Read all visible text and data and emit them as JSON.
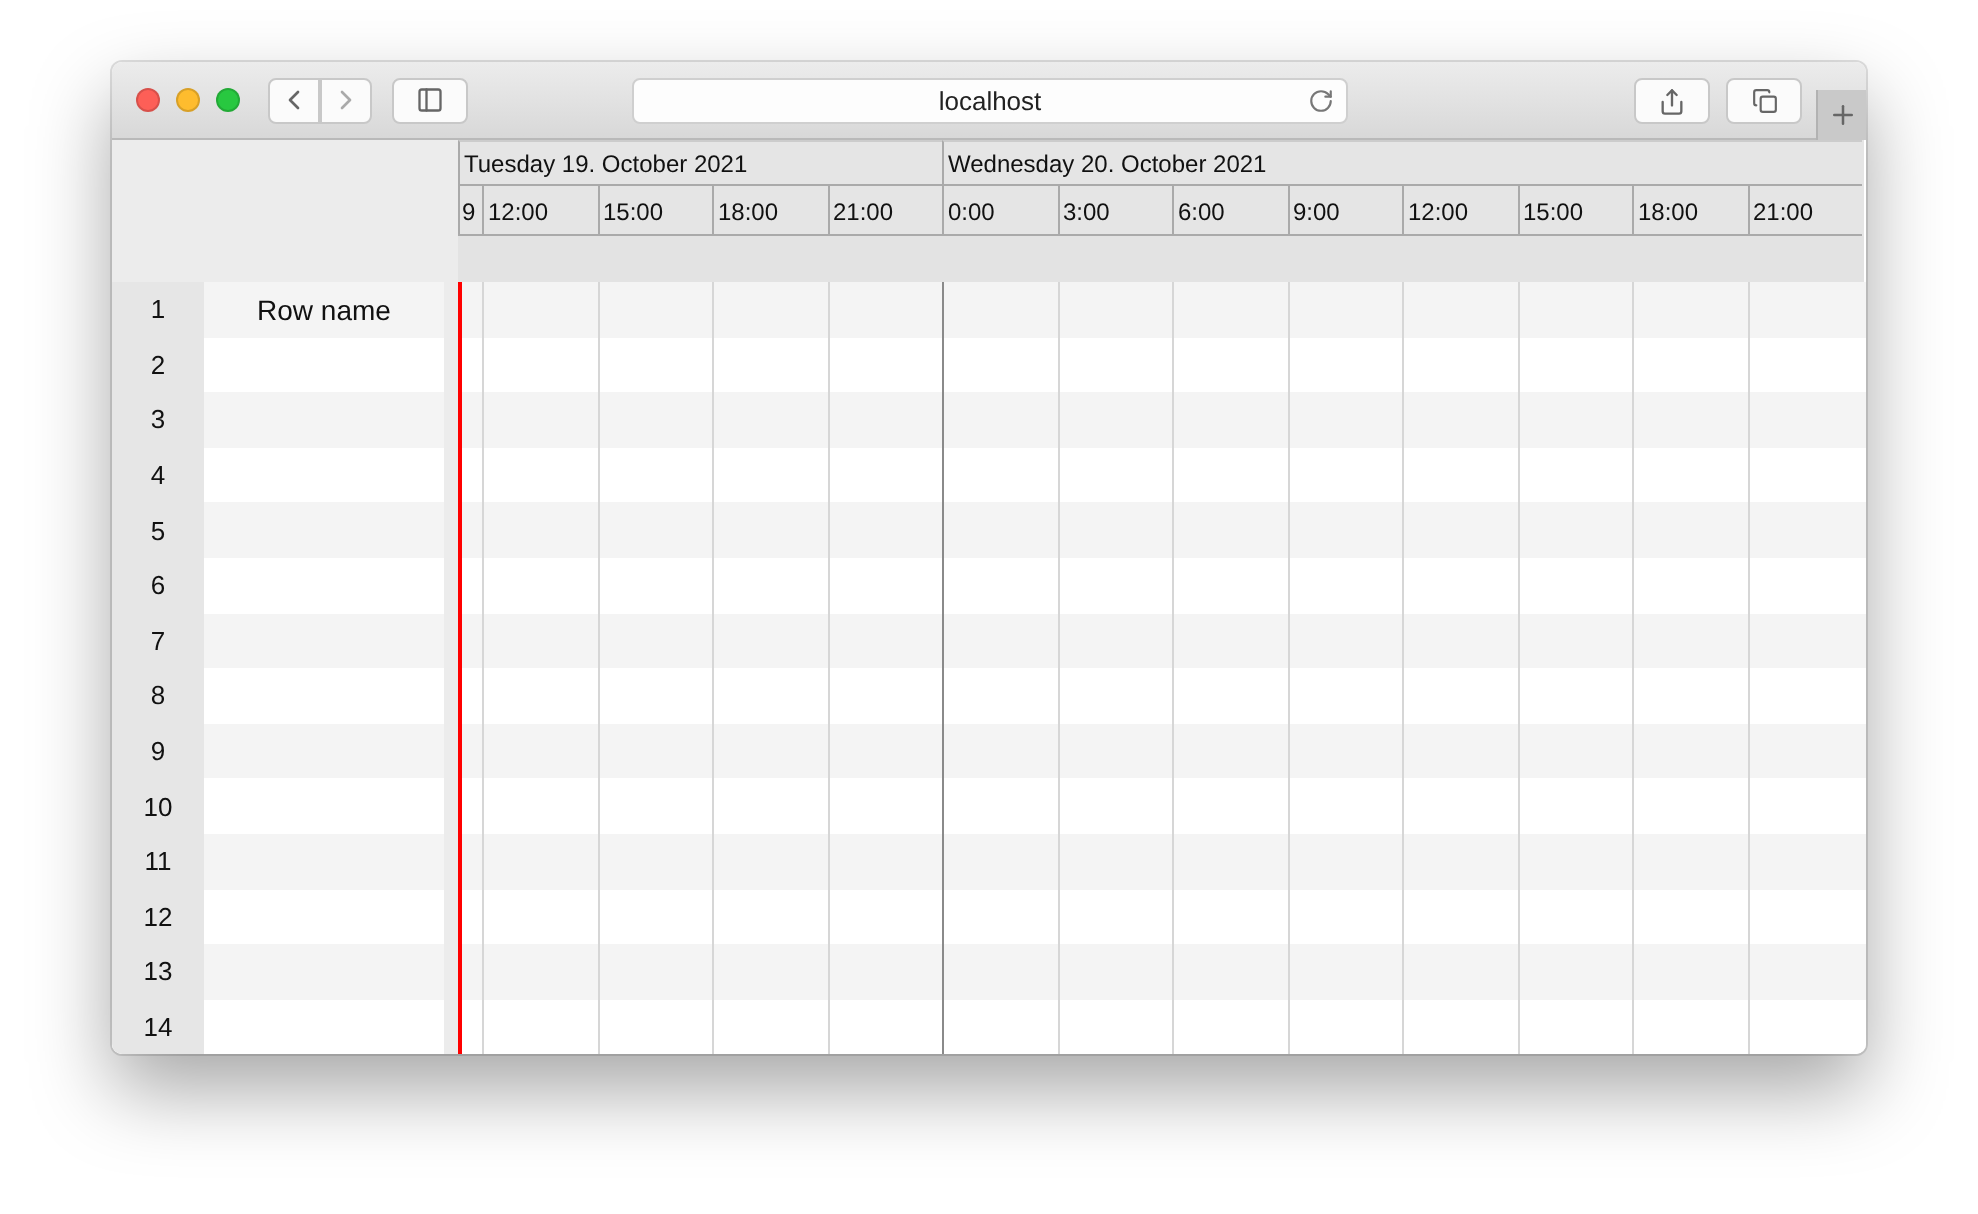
{
  "window": {
    "title": "localhost"
  },
  "days": [
    {
      "label": "Tuesday 19. October 2021",
      "hours": [
        {
          "label": "9",
          "kind": "partial"
        },
        {
          "label": "12:00",
          "kind": "full"
        },
        {
          "label": "15:00",
          "kind": "full"
        },
        {
          "label": "18:00",
          "kind": "full"
        },
        {
          "label": "21:00",
          "kind": "full"
        }
      ]
    },
    {
      "label": "Wednesday 20. October 2021",
      "hours": [
        {
          "label": "0:00",
          "kind": "full"
        },
        {
          "label": "3:00",
          "kind": "full"
        },
        {
          "label": "6:00",
          "kind": "full"
        },
        {
          "label": "9:00",
          "kind": "full"
        },
        {
          "label": "12:00",
          "kind": "full"
        },
        {
          "label": "15:00",
          "kind": "full"
        },
        {
          "label": "18:00",
          "kind": "full"
        },
        {
          "label": "21:00",
          "kind": "full"
        }
      ]
    }
  ],
  "rows": [
    {
      "number": "1",
      "name": "Row name"
    },
    {
      "number": "2"
    },
    {
      "number": "3"
    },
    {
      "number": "4"
    },
    {
      "number": "5"
    },
    {
      "number": "6"
    },
    {
      "number": "7"
    },
    {
      "number": "8"
    },
    {
      "number": "9"
    },
    {
      "number": "10"
    },
    {
      "number": "11"
    },
    {
      "number": "12"
    },
    {
      "number": "13"
    },
    {
      "number": "14"
    }
  ]
}
